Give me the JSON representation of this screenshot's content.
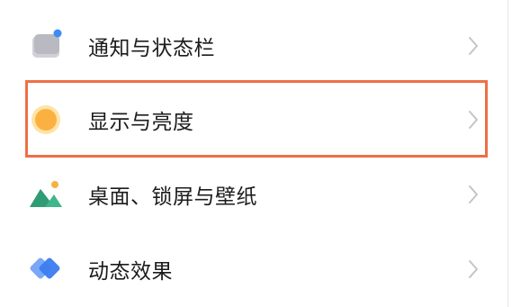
{
  "settings": {
    "items": [
      {
        "label": "通知与状态栏",
        "icon": "notification-status-bar-icon"
      },
      {
        "label": "显示与亮度",
        "icon": "display-brightness-icon"
      },
      {
        "label": "桌面、锁屏与壁纸",
        "icon": "desktop-lockscreen-wallpaper-icon"
      },
      {
        "label": "动态效果",
        "icon": "dynamic-effects-icon"
      }
    ],
    "chevron_icon": "chevron-right-icon",
    "highlighted_index": 1
  },
  "colors": {
    "highlight_border": "#ee6f45",
    "text": "#1c1c1c",
    "chevron": "#c4c4c4",
    "brightness_icon": "#fbb142",
    "wallpaper_icon_green": "#3fb68b",
    "effects_icon_blue": "#3b7cf0"
  }
}
